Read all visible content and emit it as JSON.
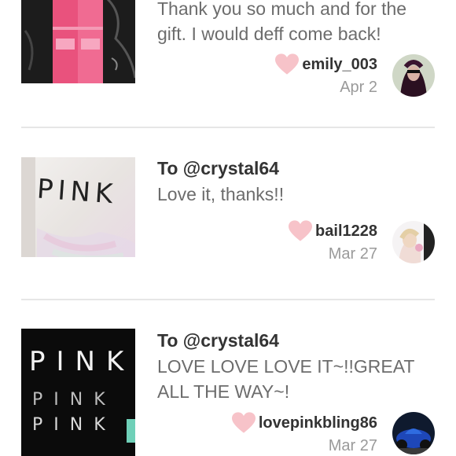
{
  "reviews": [
    {
      "to": "",
      "message": "Thank you so much and for the gift. I would deff come back!",
      "username": "emily_003",
      "date": "Apr 2",
      "thumb_icon": "pink-packaging-photo",
      "avatar_icon": "user-avatar"
    },
    {
      "to": "To @crystal64",
      "message": "Love it, thanks!!",
      "username": "bail1228",
      "date": "Mar 27",
      "thumb_icon": "pink-shirt-photo",
      "avatar_icon": "user-avatar"
    },
    {
      "to": "To @crystal64",
      "message": "LOVE LOVE LOVE IT~!!GREAT ALL THE WAY~!",
      "username": "lovepinkbling86",
      "date": "Mar 27",
      "thumb_icon": "black-pink-shirt-photo",
      "avatar_icon": "user-avatar"
    }
  ],
  "thumb_texts": {
    "shirt": "PINK",
    "black_line1": "PINK",
    "black_line2": "PINK",
    "black_line3": "PINK"
  },
  "colors": {
    "heart": "#f7c3c9",
    "divider": "#e6e6e6"
  }
}
